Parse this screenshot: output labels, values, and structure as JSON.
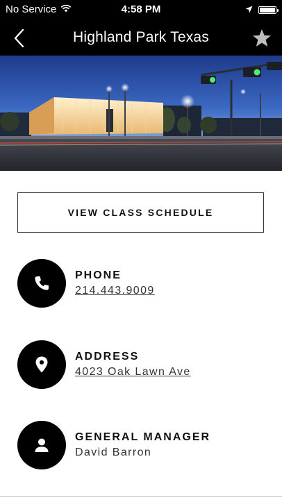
{
  "status_bar": {
    "carrier": "No Service",
    "time": "4:58 PM"
  },
  "nav": {
    "title": "Highland Park Texas",
    "back_icon": "chevron-left-icon",
    "favorite_icon": "star-icon"
  },
  "hero": {
    "description_icon": "location-photo"
  },
  "schedule_button": {
    "label": "VIEW CLASS SCHEDULE"
  },
  "phone": {
    "label": "PHONE",
    "value": "214.443.9009",
    "icon": "phone-icon"
  },
  "address": {
    "label": "ADDRESS",
    "value": "4023 Oak Lawn Ave",
    "icon": "map-pin-icon"
  },
  "manager": {
    "label": "GENERAL MANAGER",
    "value": "David Barron",
    "icon": "person-icon"
  },
  "colors": {
    "nav_background": "#000000",
    "nav_text": "#ffffff",
    "icon_circle": "#000000",
    "page_background": "#ffffff"
  }
}
